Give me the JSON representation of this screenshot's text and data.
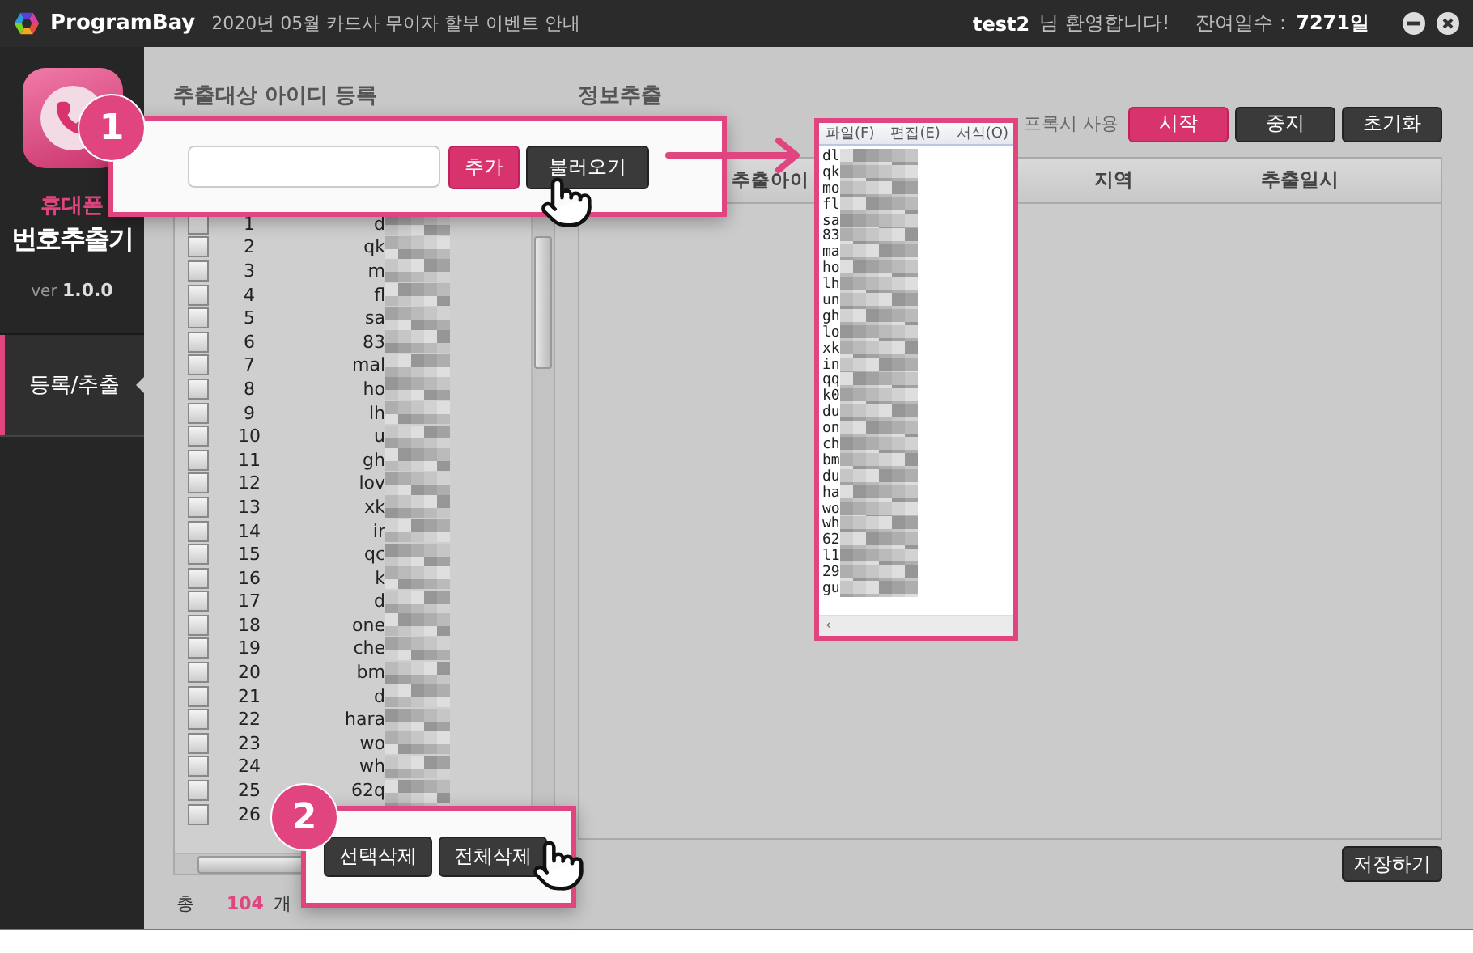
{
  "title_bar": {
    "brand": "ProgramBay",
    "notice": "2020년 05월 카드사 무이자 할부 이벤트 안내",
    "user": "test2",
    "greeting": "님 환영합니다!",
    "remaining_label": "잔여일수 :",
    "remaining_value": "7271일"
  },
  "sidebar": {
    "app_name_top": "휴대폰",
    "app_name": "번호추출기",
    "version_label": "ver",
    "version": "1.0.0",
    "items": [
      {
        "label": "등록/추출",
        "selected": true
      }
    ]
  },
  "id_panel": {
    "title": "추출대상 아이디 등록",
    "rows": [
      {
        "number": "1",
        "id": "d",
        "checked": false
      },
      {
        "number": "2",
        "id": "qk",
        "checked": false
      },
      {
        "number": "3",
        "id": "m",
        "checked": false
      },
      {
        "number": "4",
        "id": "fl",
        "checked": false
      },
      {
        "number": "5",
        "id": "sa",
        "checked": false
      },
      {
        "number": "6",
        "id": "83",
        "checked": false
      },
      {
        "number": "7",
        "id": "mal",
        "checked": false
      },
      {
        "number": "8",
        "id": "ho",
        "checked": false
      },
      {
        "number": "9",
        "id": "lh",
        "checked": false
      },
      {
        "number": "10",
        "id": "u",
        "checked": false
      },
      {
        "number": "11",
        "id": "gh",
        "checked": false
      },
      {
        "number": "12",
        "id": "lov",
        "checked": false
      },
      {
        "number": "13",
        "id": "xk",
        "checked": false
      },
      {
        "number": "14",
        "id": "ir",
        "checked": false
      },
      {
        "number": "15",
        "id": "qc",
        "checked": false
      },
      {
        "number": "16",
        "id": "k",
        "checked": false
      },
      {
        "number": "17",
        "id": "d",
        "checked": false
      },
      {
        "number": "18",
        "id": "one",
        "checked": false
      },
      {
        "number": "19",
        "id": "che",
        "checked": false
      },
      {
        "number": "20",
        "id": "bm",
        "checked": false
      },
      {
        "number": "21",
        "id": "d",
        "checked": false
      },
      {
        "number": "22",
        "id": "hara",
        "checked": false
      },
      {
        "number": "23",
        "id": "wo",
        "checked": false
      },
      {
        "number": "24",
        "id": "wh",
        "checked": false
      },
      {
        "number": "25",
        "id": "62q",
        "checked": false
      },
      {
        "number": "26",
        "checked": false
      }
    ],
    "total_label": "총",
    "total_count": "104",
    "total_unit": "개"
  },
  "extract_panel": {
    "title": "정보추출",
    "proxy_label": "프록시 사용",
    "buttons": [
      {
        "label": "시작",
        "kind": "primary"
      },
      {
        "label": "중지",
        "kind": "dark"
      },
      {
        "label": "초기화",
        "kind": "dark"
      }
    ],
    "columns": [
      "추출아이",
      "지역",
      "추출일시"
    ],
    "save_button": "저장하기"
  },
  "callouts": [
    {
      "badge": "1",
      "add_button": "추가",
      "load_button": "불러오기"
    },
    {
      "badge": "2",
      "buttons": [
        "선택삭제",
        "전체삭제"
      ]
    }
  ],
  "notepad": {
    "menu": [
      "파일(F)",
      "편집(E)",
      "서식(O)"
    ],
    "lines": [
      "dl",
      "qk",
      "mo",
      "fl",
      "sa",
      "83",
      "ma",
      "ho",
      "lh",
      "un",
      "gh",
      "lo",
      "xk",
      "in",
      "qq",
      "k0",
      "du",
      "on",
      "ch",
      "bm",
      "du",
      "ha",
      "wo",
      "wh",
      "62",
      "l1",
      "29",
      "gu"
    ],
    "scroll_arrow": "‹"
  }
}
